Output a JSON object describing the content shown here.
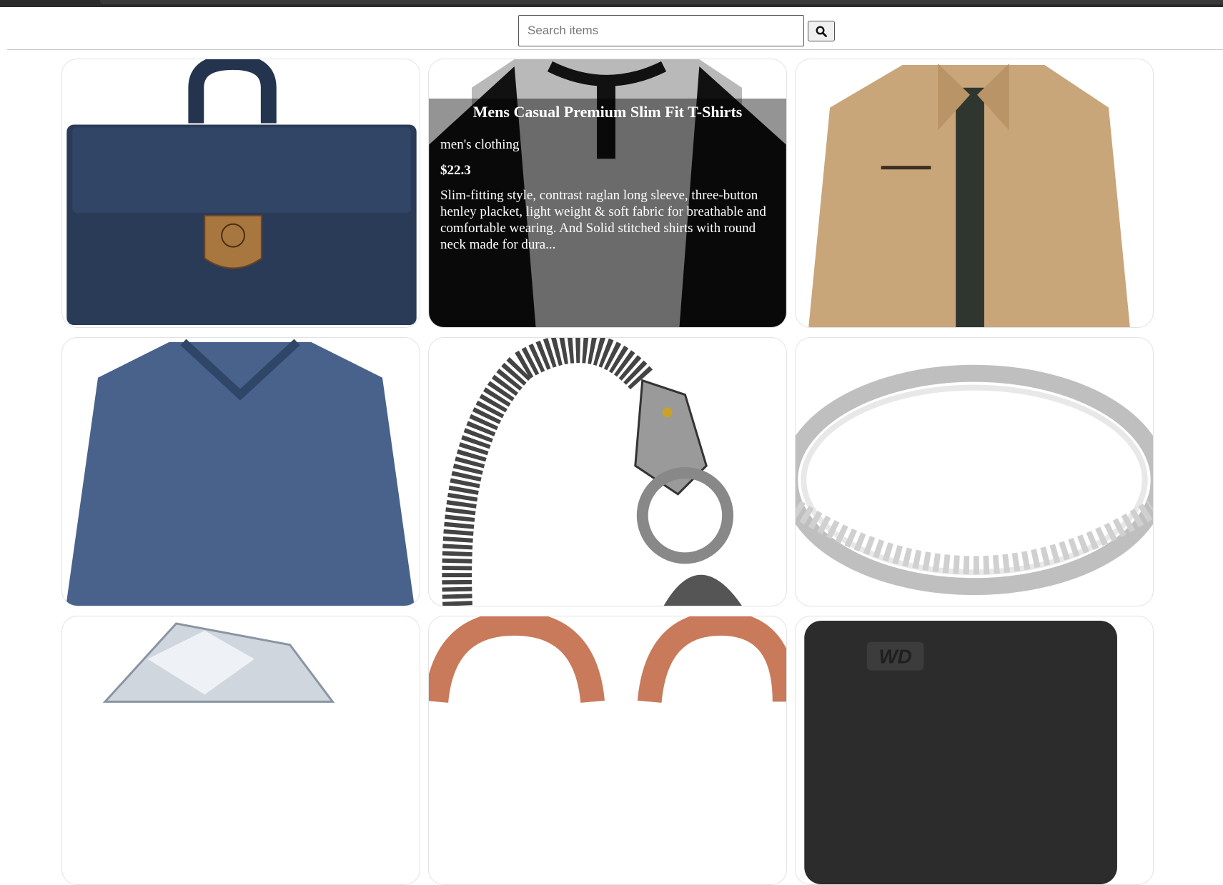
{
  "search": {
    "placeholder": "Search items",
    "value": ""
  },
  "icons": {
    "search_button": "search-icon"
  },
  "products": [
    {
      "image": "navy canvas backpack with leather fox patch"
    },
    {
      "image": "grey and black raglan henley shirt",
      "hover_overlay": {
        "title": "Mens Casual Premium Slim Fit T-Shirts",
        "category": "men's clothing",
        "price": "$22.3",
        "description": "Slim-fitting style, contrast raglan long sleeve, three-button henley placket, light weight & soft fabric for breathable and comfortable wearing. And Solid stitched shirts with round neck made for dura..."
      }
    },
    {
      "image": "khaki cotton jacket"
    },
    {
      "image": "blue long sleeve v-neck shirt"
    },
    {
      "image": "silver dragon chain bracelet"
    },
    {
      "image": "silver diamond bangle ring"
    },
    {
      "image": "diamond halo ring"
    },
    {
      "image": "rose gold band rings"
    },
    {
      "image": "black WD external hard drive"
    }
  ],
  "colors": {
    "overlay": "rgba(0,0,0,0.42)",
    "card_border": "#e2e2e2"
  }
}
